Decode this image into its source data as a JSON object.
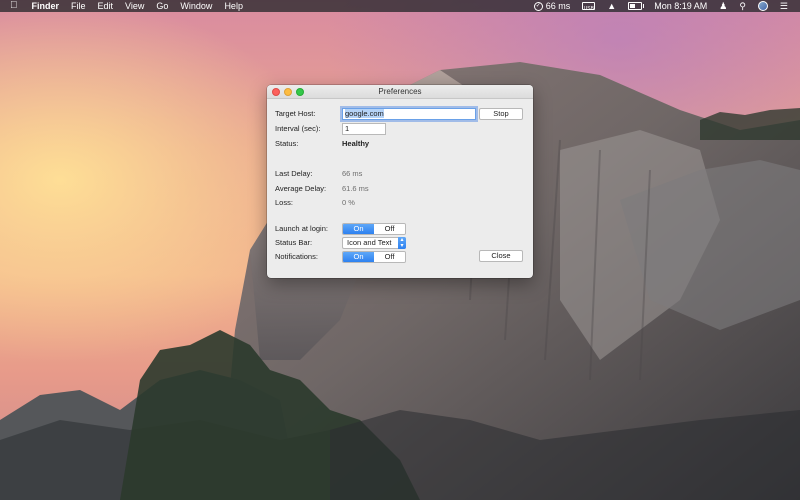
{
  "menubar": {
    "app_name": "Finder",
    "menus": [
      "File",
      "Edit",
      "View",
      "Go",
      "Window",
      "Help"
    ],
    "status_item": "66 ms",
    "status_box": "USB",
    "clock": "Mon 8:19 AM"
  },
  "window": {
    "title": "Preferences",
    "labels": {
      "target_host": "Target Host:",
      "interval": "Interval (sec):",
      "status": "Status:",
      "last_delay": "Last Delay:",
      "average_delay": "Average Delay:",
      "loss": "Loss:",
      "launch_at_login": "Launch at login:",
      "status_bar": "Status Bar:",
      "notifications": "Notifications:"
    },
    "values": {
      "target_host": "google.com",
      "interval": "1",
      "status": "Healthy",
      "last_delay": "66 ms",
      "average_delay": "61.6 ms",
      "loss": "0 %",
      "status_bar": "Icon and Text"
    },
    "buttons": {
      "stop": "Stop",
      "close": "Close"
    },
    "segments": {
      "on": "On",
      "off": "Off"
    },
    "launch_at_login_selected": "On",
    "notifications_selected": "On"
  },
  "icons": {
    "apple": "apple-icon",
    "status": "ping-status-icon",
    "wifi": "wifi-icon",
    "battery": "battery-icon",
    "user": "user-icon",
    "search": "search-icon",
    "siri": "siri-icon",
    "notification_center": "notification-center-icon"
  },
  "colors": {
    "accent": "#2e81f0",
    "focus_ring": "#6aa1e8"
  }
}
